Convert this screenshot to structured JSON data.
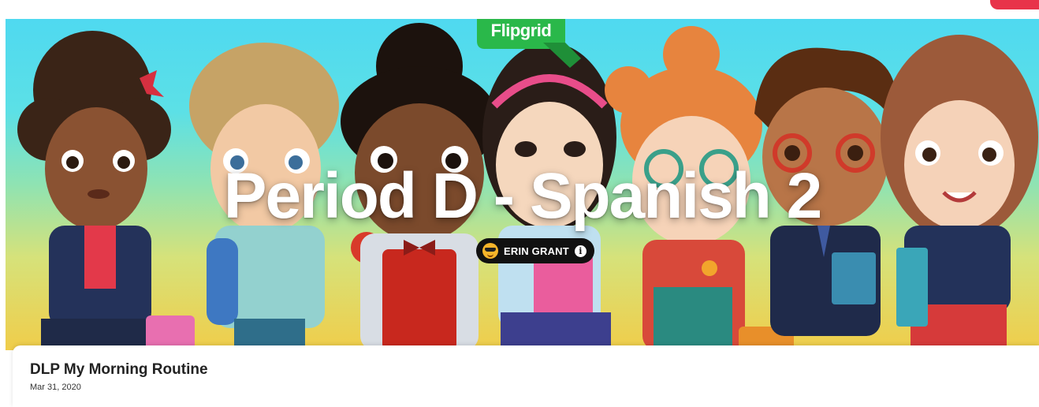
{
  "app": {
    "logo_text": "Flipgrid"
  },
  "banner": {
    "title": "Period D - Spanish 2",
    "owner_name": "ERIN GRANT",
    "owner_avatar_icon": "sunglasses-emoji-icon",
    "info_icon": "info-icon",
    "colors": {
      "sky": "#4fd9f0",
      "ground": "#f0cd4a",
      "logo_green": "#2ab84a"
    }
  },
  "topic": {
    "title": "DLP My Morning Routine",
    "date": "Mar 31, 2020"
  }
}
